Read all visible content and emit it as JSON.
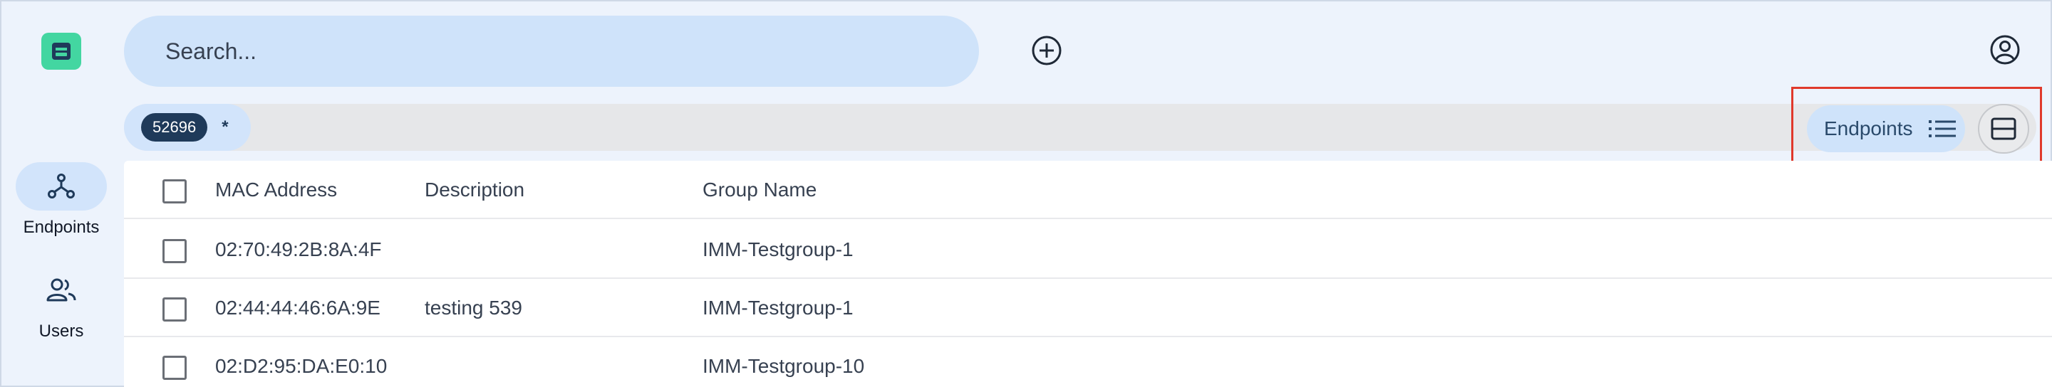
{
  "nav": {
    "items": [
      {
        "id": "endpoints",
        "label": "Endpoints",
        "icon": "graph-nodes-icon",
        "active": true
      },
      {
        "id": "users",
        "label": "Users",
        "icon": "users-icon",
        "active": false
      }
    ]
  },
  "header": {
    "search_placeholder": "Search..."
  },
  "filter": {
    "count": "52696",
    "asterisk": "*"
  },
  "view_toggle": {
    "label": "Endpoints",
    "icon": "list-icon"
  },
  "table": {
    "columns": [
      "MAC Address",
      "Description",
      "Group Name"
    ],
    "rows": [
      {
        "mac": "02:70:49:2B:8A:4F",
        "description": "",
        "group": "IMM-Testgroup-1"
      },
      {
        "mac": "02:44:44:46:6A:9E",
        "description": "testing 539",
        "group": "IMM-Testgroup-1"
      },
      {
        "mac": "02:D2:95:DA:E0:10",
        "description": "",
        "group": "IMM-Testgroup-10"
      }
    ]
  },
  "colors": {
    "brand": "#43d6a1",
    "accent_light": "#cfe3fa",
    "highlight": "#e0392b"
  }
}
